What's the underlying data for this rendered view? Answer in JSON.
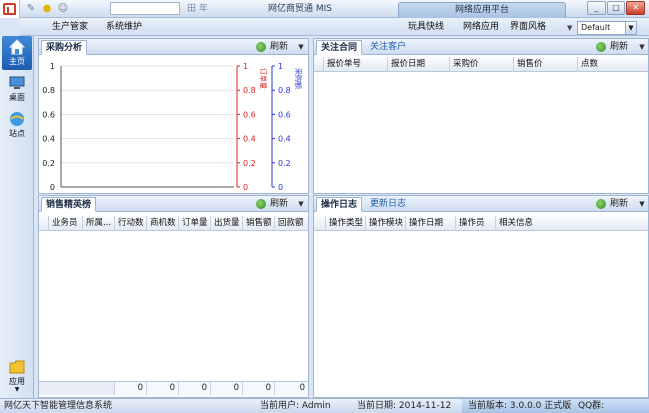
{
  "titlebar": {
    "title": "网亿商贸通 MIS",
    "glyph": "田 年",
    "quick_icons": [
      "pencil-icon",
      "lightbulb-icon",
      "user-icon"
    ]
  },
  "menubar": {
    "left_menus": [
      "生产管家",
      "系统维护"
    ],
    "right_menus": [
      "玩具快线",
      "网络应用",
      "界面风格"
    ],
    "platform_tab": "网络应用平台",
    "theme": "Default"
  },
  "leftnav": {
    "items": [
      {
        "label": "主页",
        "icon": "home-icon",
        "active": true
      },
      {
        "label": "桌面",
        "icon": "desktop-icon",
        "active": false
      },
      {
        "label": "站点",
        "icon": "ie-globe-icon",
        "active": false
      }
    ],
    "bottom": {
      "label": "应用",
      "icon": "folder-icon"
    }
  },
  "purchase_panel": {
    "tab": "采购分析",
    "refresh": "刷新",
    "chart_data": {
      "type": "line",
      "series": [],
      "left_axis": {
        "ticks": [
          "1",
          "0.8",
          "0.6",
          "0.4",
          "0.2",
          "0"
        ],
        "ylim": [
          0,
          1
        ]
      },
      "right_axis_1": {
        "label": "订单量",
        "ticks": [
          "1",
          "0.8",
          "0.6",
          "0.4",
          "0.2",
          "0"
        ],
        "ylim": [
          0,
          1
        ],
        "color": "#e02020"
      },
      "right_axis_2": {
        "label": "采购额",
        "ticks": [
          "1",
          "0.8",
          "0.6",
          "0.4",
          "0.2",
          "0"
        ],
        "ylim": [
          0,
          1
        ],
        "color": "#2a35d8"
      },
      "grid": true
    }
  },
  "contract_panel": {
    "tabs": [
      "关注合同",
      "关注客户"
    ],
    "refresh": "刷新",
    "columns": [
      "报价单号",
      "报价日期",
      "采购价",
      "销售价",
      "点数"
    ]
  },
  "sales_panel": {
    "tab": "销售精英榜",
    "refresh": "刷新",
    "columns": [
      "业务员",
      "所属...",
      "行动数",
      "商机数",
      "订单量",
      "出货量",
      "销售额",
      "回款额"
    ],
    "footer": [
      "0",
      "0",
      "0",
      "0",
      "0",
      "0"
    ]
  },
  "log_panel": {
    "tabs": [
      "操作日志",
      "更新日志"
    ],
    "refresh": "刷新",
    "columns": [
      "操作类型",
      "操作模块",
      "操作日期",
      "操作员",
      "相关信息"
    ]
  },
  "status": {
    "app_name": "网亿天下智能管理信息系统",
    "user": "当前用户: Admin",
    "date": "当前日期: 2014-11-12",
    "version": "当前版本: 3.0.0.0 正式版",
    "qq": "QQ群: 83881058"
  },
  "colors": {
    "accent": "#1d5cae",
    "axis_red": "#e02020",
    "axis_blue": "#2a35d8"
  }
}
